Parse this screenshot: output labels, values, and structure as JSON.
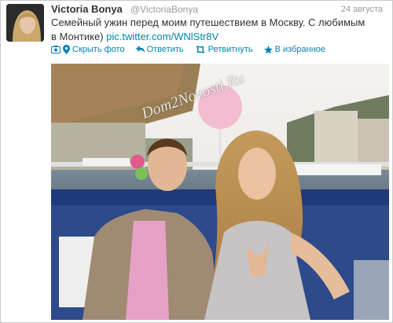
{
  "tweet": {
    "author_name": "Victoria Bonya",
    "author_handle": "@VictoriaBonya",
    "date": "24 августа",
    "text_line1": "Семейный ужин перед моим путешествием в Москву. С любимым",
    "text_line2_prefix": "в Монтике)",
    "link": "pic.twitter.com/WNlStr8V"
  },
  "actions": {
    "hide_photo": "Скрыть фото",
    "reply": "Ответить",
    "retweet": "Ретвитнуть",
    "favorite": "В избранное"
  },
  "photo": {
    "watermark": "Dom2Novosti.Ru"
  },
  "colors": {
    "link": "#0084b4",
    "name": "#333333",
    "meta": "#999999"
  }
}
